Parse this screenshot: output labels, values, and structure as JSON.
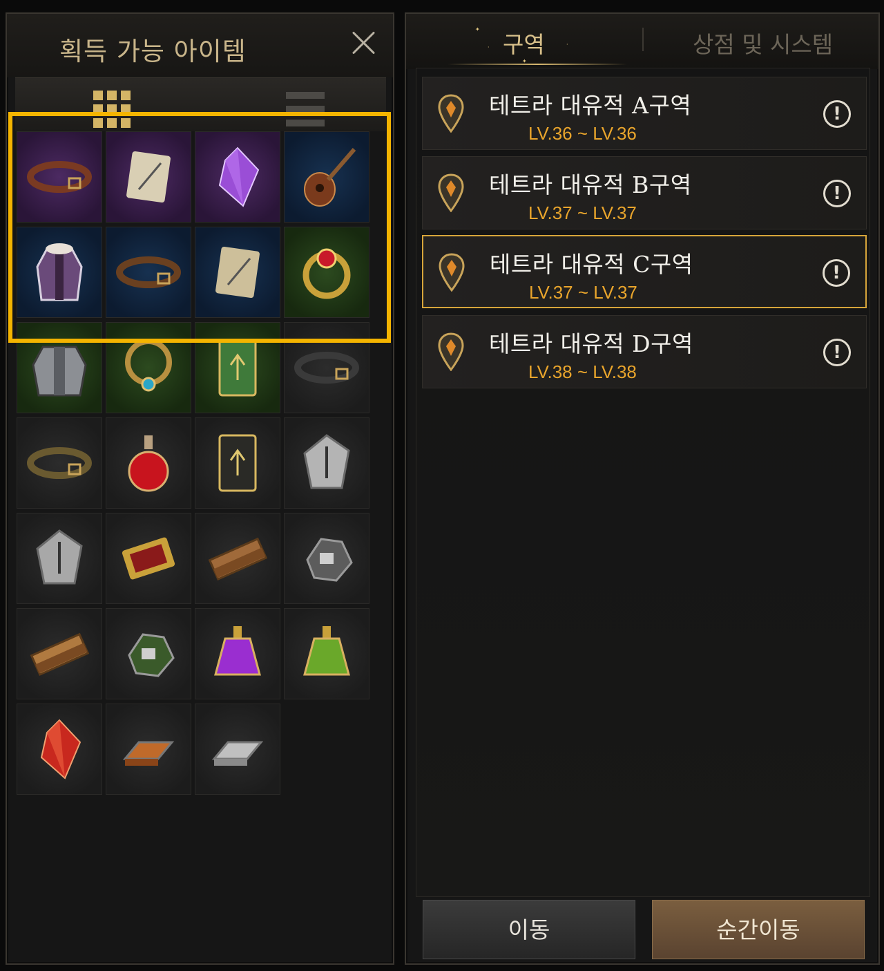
{
  "left_panel": {
    "title": "획득 가능 아이템",
    "close_icon": "close-icon",
    "view_modes": [
      {
        "name": "grid-view",
        "icon": "grid-icon",
        "active": true
      },
      {
        "name": "list-view",
        "icon": "list-icon",
        "active": false
      }
    ],
    "items": [
      {
        "name": "belt-purple",
        "icon": "belt-icon",
        "rarity": "purple",
        "highlighted": true
      },
      {
        "name": "sword-scroll",
        "icon": "scroll-icon",
        "rarity": "purple",
        "highlighted": true
      },
      {
        "name": "purple-crystal",
        "icon": "crystal-icon",
        "rarity": "purple",
        "highlighted": true
      },
      {
        "name": "lute",
        "icon": "lute-icon",
        "rarity": "blue",
        "highlighted": true
      },
      {
        "name": "fur-coat",
        "icon": "coat-icon",
        "rarity": "blue",
        "highlighted": true
      },
      {
        "name": "leather-belt",
        "icon": "belt-icon",
        "rarity": "blue",
        "highlighted": true
      },
      {
        "name": "tied-scroll",
        "icon": "scroll-icon",
        "rarity": "blue",
        "highlighted": true
      },
      {
        "name": "ruby-ring",
        "icon": "ring-icon",
        "rarity": "green",
        "highlighted": true
      },
      {
        "name": "plate-armor",
        "icon": "armor-icon",
        "rarity": "green"
      },
      {
        "name": "jeweled-necklace",
        "icon": "necklace-icon",
        "rarity": "green"
      },
      {
        "name": "green-card",
        "icon": "card-icon",
        "rarity": "green"
      },
      {
        "name": "gray-belt",
        "icon": "belt-icon",
        "rarity": "gray"
      },
      {
        "name": "simple-belt",
        "icon": "belt-icon",
        "rarity": "gray"
      },
      {
        "name": "red-potion",
        "icon": "potion-icon",
        "rarity": "gray"
      },
      {
        "name": "dark-card",
        "icon": "card-icon",
        "rarity": "gray"
      },
      {
        "name": "sword-stone",
        "icon": "stone-icon",
        "rarity": "gray"
      },
      {
        "name": "ring-stone",
        "icon": "stone-icon",
        "rarity": "gray"
      },
      {
        "name": "golden-ticket",
        "icon": "ticket-icon",
        "rarity": "gray"
      },
      {
        "name": "wood-planks",
        "icon": "wood-icon",
        "rarity": "gray"
      },
      {
        "name": "iron-ore",
        "icon": "ore-icon",
        "rarity": "gray"
      },
      {
        "name": "wood-log",
        "icon": "wood-icon",
        "rarity": "gray"
      },
      {
        "name": "green-ore",
        "icon": "ore-icon",
        "rarity": "gray"
      },
      {
        "name": "purple-elixir",
        "icon": "flask-icon",
        "rarity": "gray"
      },
      {
        "name": "green-elixir",
        "icon": "flask-icon",
        "rarity": "gray"
      },
      {
        "name": "red-crystal",
        "icon": "crystal-icon",
        "rarity": "gray"
      },
      {
        "name": "copper-ingot",
        "icon": "ingot-icon",
        "rarity": "gray"
      },
      {
        "name": "silver-ingot",
        "icon": "ingot-icon",
        "rarity": "gray"
      }
    ]
  },
  "right_panel": {
    "tabs": [
      {
        "label": "구역",
        "active": true
      },
      {
        "label": "상점 및 시스템",
        "active": false
      }
    ],
    "areas": [
      {
        "name": "테트라 대유적 A구역",
        "level": "LV.36 ~ LV.36",
        "selected": false
      },
      {
        "name": "테트라 대유적 B구역",
        "level": "LV.37 ~ LV.37",
        "selected": false
      },
      {
        "name": "테트라 대유적 C구역",
        "level": "LV.37 ~ LV.37",
        "selected": true
      },
      {
        "name": "테트라 대유적 D구역",
        "level": "LV.38 ~ LV.38",
        "selected": false
      }
    ],
    "buttons": {
      "move": "이동",
      "teleport": "순간이동"
    }
  },
  "colors": {
    "accent_gold": "#d7b870",
    "selection_yellow": "#f4b400",
    "level_orange": "#e9a52c"
  }
}
